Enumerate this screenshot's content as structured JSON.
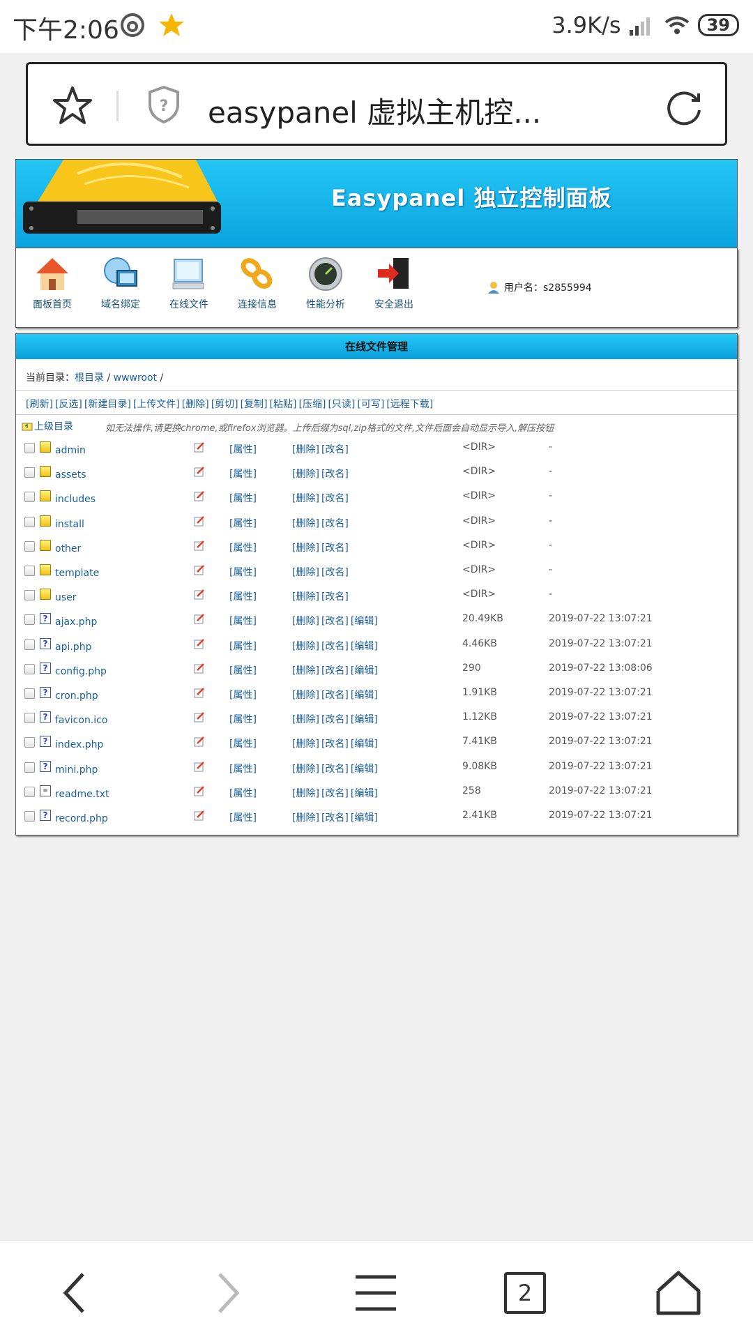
{
  "status_bar": {
    "time": "下午2:06",
    "speed": "3.9K/s",
    "battery": "39"
  },
  "address_bar": {
    "title": "easypanel 虚拟主机控..."
  },
  "banner": {
    "title": "Easypanel 独立控制面板"
  },
  "nav": {
    "items": [
      {
        "label": "面板首页",
        "icon": "house-icon"
      },
      {
        "label": "域名绑定",
        "icon": "globe-icon"
      },
      {
        "label": "在线文件",
        "icon": "computer-icon"
      },
      {
        "label": "连接信息",
        "icon": "link-icon"
      },
      {
        "label": "性能分析",
        "icon": "gauge-icon"
      },
      {
        "label": "安全退出",
        "icon": "exit-icon"
      }
    ],
    "user_label": "用户名：s2855994"
  },
  "file_manager": {
    "header": "在线文件管理",
    "current_dir_label": "当前目录：",
    "root_link": "根目录",
    "path_sep1": " / ",
    "wwwroot_link": "wwwroot",
    "path_sep2": " /",
    "toolbar": [
      "[刷新]",
      "[反选]",
      "[新建目录]",
      "[上传文件]",
      "[删除]",
      "[剪切]",
      "[复制]",
      "[粘贴]",
      "[压缩]",
      "[只读]",
      "[可写]",
      "[远程下载]"
    ],
    "up_label": "上级目录",
    "note": "如无法操作,请更换chrome,或firefox浏览器。上传后缀为sql,zip格式的文件,文件后面会自动显示导入,解压按钮",
    "attr_label": "[属性]",
    "delete_label": "[删除]",
    "rename_label": "[改名]",
    "edit_label": "[编辑]",
    "rows": [
      {
        "name": "admin",
        "type": "dir",
        "size": "<DIR>",
        "date": "-"
      },
      {
        "name": "assets",
        "type": "dir",
        "size": "<DIR>",
        "date": "-"
      },
      {
        "name": "includes",
        "type": "dir",
        "size": "<DIR>",
        "date": "-"
      },
      {
        "name": "install",
        "type": "dir",
        "size": "<DIR>",
        "date": "-"
      },
      {
        "name": "other",
        "type": "dir",
        "size": "<DIR>",
        "date": "-"
      },
      {
        "name": "template",
        "type": "dir",
        "size": "<DIR>",
        "date": "-"
      },
      {
        "name": "user",
        "type": "dir",
        "size": "<DIR>",
        "date": "-"
      },
      {
        "name": "ajax.php",
        "type": "unknown",
        "size": "20.49KB",
        "date": "2019-07-22 13:07:21"
      },
      {
        "name": "api.php",
        "type": "unknown",
        "size": "4.46KB",
        "date": "2019-07-22 13:07:21"
      },
      {
        "name": "config.php",
        "type": "unknown",
        "size": "290",
        "date": "2019-07-22 13:08:06"
      },
      {
        "name": "cron.php",
        "type": "unknown",
        "size": "1.91KB",
        "date": "2019-07-22 13:07:21"
      },
      {
        "name": "favicon.ico",
        "type": "unknown",
        "size": "1.12KB",
        "date": "2019-07-22 13:07:21"
      },
      {
        "name": "index.php",
        "type": "unknown",
        "size": "7.41KB",
        "date": "2019-07-22 13:07:21"
      },
      {
        "name": "mini.php",
        "type": "unknown",
        "size": "9.08KB",
        "date": "2019-07-22 13:07:21"
      },
      {
        "name": "readme.txt",
        "type": "text",
        "size": "258",
        "date": "2019-07-22 13:07:21"
      },
      {
        "name": "record.php",
        "type": "unknown",
        "size": "2.41KB",
        "date": "2019-07-22 13:07:21"
      }
    ]
  },
  "bottom_nav": {
    "tabs_count": "2"
  }
}
